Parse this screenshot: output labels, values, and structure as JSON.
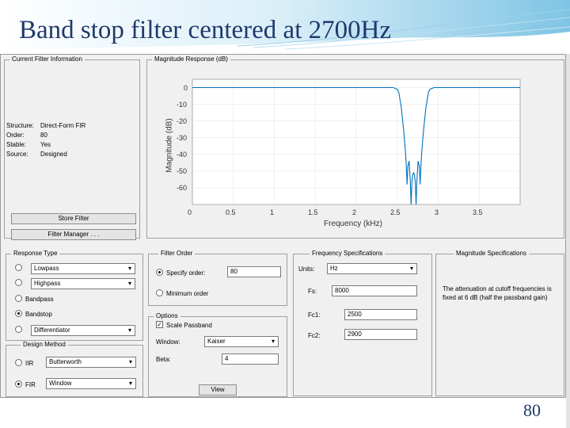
{
  "slide": {
    "title": "Band stop filter centered at 2700Hz",
    "page_number": "80"
  },
  "current_filter": {
    "title": "Current Filter Information",
    "fields": [
      {
        "label": "Structure:",
        "value": "Direct-Form FIR"
      },
      {
        "label": "Order:",
        "value": "80"
      },
      {
        "label": "Stable:",
        "value": "Yes"
      },
      {
        "label": "Source:",
        "value": "Designed"
      }
    ],
    "store_button": "Store Filter",
    "manager_button": "Filter Manager . . ."
  },
  "magnitude_plot": {
    "title": "Magnitude Response (dB)",
    "ylabel": "Magnitude (dB)",
    "xlabel": "Frequency (kHz)",
    "y_ticks": [
      "0",
      "-10",
      "-20",
      "-30",
      "-40",
      "-50",
      "-60"
    ],
    "x_ticks": [
      "0",
      "0.5",
      "1",
      "1.5",
      "2",
      "2.5",
      "3",
      "3.5"
    ],
    "line_color": "#0072bd"
  },
  "chart_data": {
    "type": "line",
    "xlabel": "Frequency (kHz)",
    "ylabel": "Magnitude (dB)",
    "xlim": [
      0,
      4
    ],
    "ylim": [
      -70,
      5
    ],
    "series": [
      {
        "x": [
          0,
          2.45,
          2.5,
          2.52,
          2.55,
          2.58,
          2.6,
          2.61,
          2.62,
          2.63,
          2.645,
          2.66,
          2.67,
          2.68,
          2.69,
          2.7,
          2.71,
          2.72,
          2.73,
          2.74,
          2.755,
          2.77,
          2.78,
          2.79,
          2.8,
          2.82,
          2.85,
          2.88,
          2.9,
          2.95,
          4
        ],
        "y": [
          0,
          0,
          -1,
          -3,
          -12,
          -26,
          -38,
          -46,
          -58,
          -47,
          -44,
          -56,
          -70,
          -56,
          -52,
          -51,
          -52,
          -56,
          -70,
          -56,
          -44,
          -47,
          -58,
          -46,
          -38,
          -26,
          -12,
          -3,
          -1,
          0,
          0
        ]
      }
    ]
  },
  "response_type": {
    "title": "Response Type",
    "options": [
      {
        "label": "",
        "combo": "Lowpass",
        "selected": false
      },
      {
        "label": "",
        "combo": "Highpass",
        "selected": false
      },
      {
        "label": "Bandpass",
        "combo": "",
        "selected": false
      },
      {
        "label": "Bandstop",
        "combo": "",
        "selected": true
      },
      {
        "label": "",
        "combo": "Differentiator",
        "selected": false
      }
    ]
  },
  "design_method": {
    "title": "Design Method",
    "iir_label": "IIR",
    "iir_value": "Butterworth",
    "fir_label": "FIR",
    "fir_value": "Window"
  },
  "filter_order": {
    "title": "Filter Order",
    "specify_label": "Specify order:",
    "specify_value": "80",
    "minimum_label": "Minimum order"
  },
  "options": {
    "title": "Options",
    "scale_label": "Scale Passband",
    "window_label": "Window:",
    "window_value": "Kaiser",
    "beta_label": "Beta:",
    "beta_value": "4",
    "view_button": "View"
  },
  "freq_spec": {
    "title": "Frequency Specifications",
    "units_label": "Units:",
    "units_value": "Hz",
    "fs_label": "Fs:",
    "fs_value": "8000",
    "fc1_label": "Fc1:",
    "fc1_value": "2500",
    "fc2_label": "Fc2:",
    "fc2_value": "2900"
  },
  "mag_spec": {
    "title": "Magnitude Specifications",
    "note": "The attenuation at cutoff frequencies is fixed at 6 dB (half the passband gain)"
  }
}
